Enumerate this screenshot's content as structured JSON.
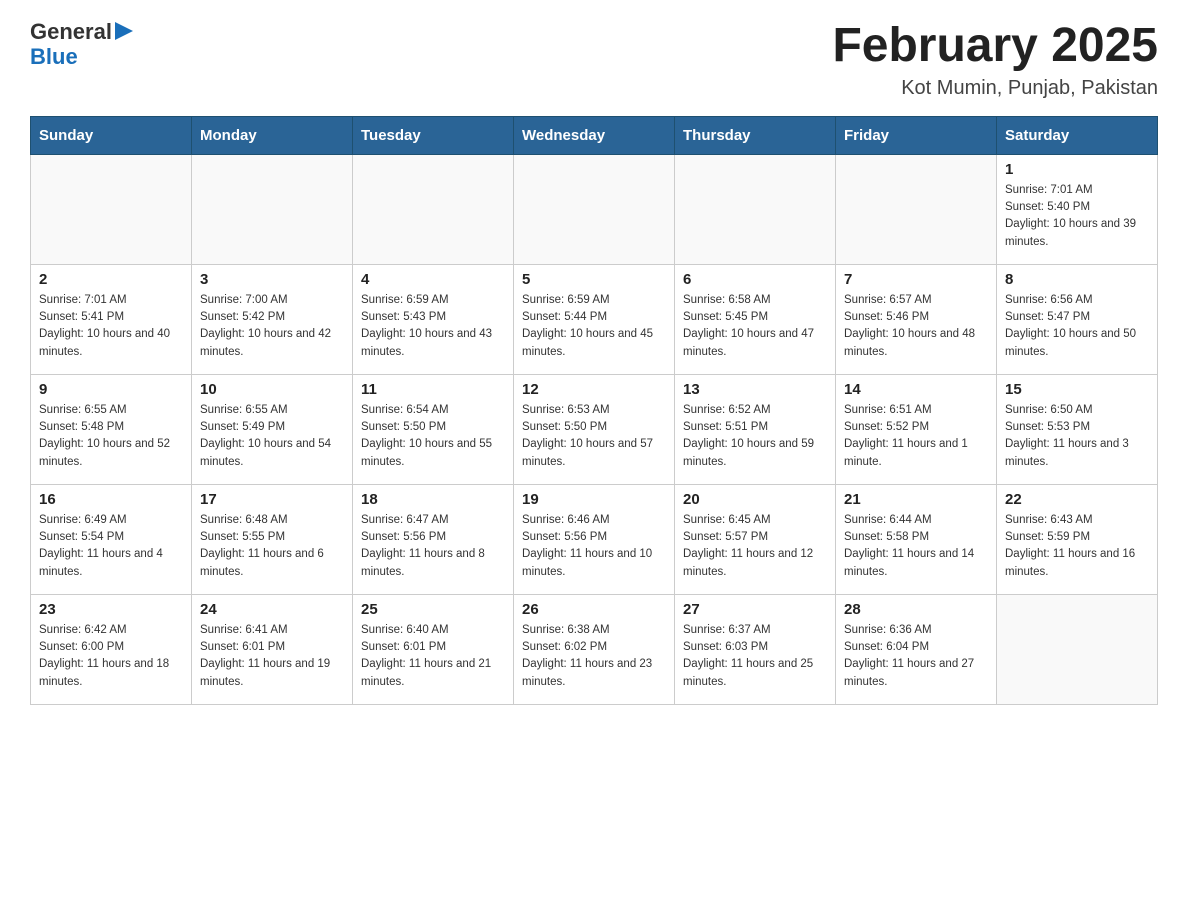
{
  "header": {
    "logo_general": "General",
    "logo_blue": "Blue",
    "month_title": "February 2025",
    "location": "Kot Mumin, Punjab, Pakistan"
  },
  "days_of_week": [
    "Sunday",
    "Monday",
    "Tuesday",
    "Wednesday",
    "Thursday",
    "Friday",
    "Saturday"
  ],
  "weeks": [
    [
      {
        "day": "",
        "sunrise": "",
        "sunset": "",
        "daylight": ""
      },
      {
        "day": "",
        "sunrise": "",
        "sunset": "",
        "daylight": ""
      },
      {
        "day": "",
        "sunrise": "",
        "sunset": "",
        "daylight": ""
      },
      {
        "day": "",
        "sunrise": "",
        "sunset": "",
        "daylight": ""
      },
      {
        "day": "",
        "sunrise": "",
        "sunset": "",
        "daylight": ""
      },
      {
        "day": "",
        "sunrise": "",
        "sunset": "",
        "daylight": ""
      },
      {
        "day": "1",
        "sunrise": "Sunrise: 7:01 AM",
        "sunset": "Sunset: 5:40 PM",
        "daylight": "Daylight: 10 hours and 39 minutes."
      }
    ],
    [
      {
        "day": "2",
        "sunrise": "Sunrise: 7:01 AM",
        "sunset": "Sunset: 5:41 PM",
        "daylight": "Daylight: 10 hours and 40 minutes."
      },
      {
        "day": "3",
        "sunrise": "Sunrise: 7:00 AM",
        "sunset": "Sunset: 5:42 PM",
        "daylight": "Daylight: 10 hours and 42 minutes."
      },
      {
        "day": "4",
        "sunrise": "Sunrise: 6:59 AM",
        "sunset": "Sunset: 5:43 PM",
        "daylight": "Daylight: 10 hours and 43 minutes."
      },
      {
        "day": "5",
        "sunrise": "Sunrise: 6:59 AM",
        "sunset": "Sunset: 5:44 PM",
        "daylight": "Daylight: 10 hours and 45 minutes."
      },
      {
        "day": "6",
        "sunrise": "Sunrise: 6:58 AM",
        "sunset": "Sunset: 5:45 PM",
        "daylight": "Daylight: 10 hours and 47 minutes."
      },
      {
        "day": "7",
        "sunrise": "Sunrise: 6:57 AM",
        "sunset": "Sunset: 5:46 PM",
        "daylight": "Daylight: 10 hours and 48 minutes."
      },
      {
        "day": "8",
        "sunrise": "Sunrise: 6:56 AM",
        "sunset": "Sunset: 5:47 PM",
        "daylight": "Daylight: 10 hours and 50 minutes."
      }
    ],
    [
      {
        "day": "9",
        "sunrise": "Sunrise: 6:55 AM",
        "sunset": "Sunset: 5:48 PM",
        "daylight": "Daylight: 10 hours and 52 minutes."
      },
      {
        "day": "10",
        "sunrise": "Sunrise: 6:55 AM",
        "sunset": "Sunset: 5:49 PM",
        "daylight": "Daylight: 10 hours and 54 minutes."
      },
      {
        "day": "11",
        "sunrise": "Sunrise: 6:54 AM",
        "sunset": "Sunset: 5:50 PM",
        "daylight": "Daylight: 10 hours and 55 minutes."
      },
      {
        "day": "12",
        "sunrise": "Sunrise: 6:53 AM",
        "sunset": "Sunset: 5:50 PM",
        "daylight": "Daylight: 10 hours and 57 minutes."
      },
      {
        "day": "13",
        "sunrise": "Sunrise: 6:52 AM",
        "sunset": "Sunset: 5:51 PM",
        "daylight": "Daylight: 10 hours and 59 minutes."
      },
      {
        "day": "14",
        "sunrise": "Sunrise: 6:51 AM",
        "sunset": "Sunset: 5:52 PM",
        "daylight": "Daylight: 11 hours and 1 minute."
      },
      {
        "day": "15",
        "sunrise": "Sunrise: 6:50 AM",
        "sunset": "Sunset: 5:53 PM",
        "daylight": "Daylight: 11 hours and 3 minutes."
      }
    ],
    [
      {
        "day": "16",
        "sunrise": "Sunrise: 6:49 AM",
        "sunset": "Sunset: 5:54 PM",
        "daylight": "Daylight: 11 hours and 4 minutes."
      },
      {
        "day": "17",
        "sunrise": "Sunrise: 6:48 AM",
        "sunset": "Sunset: 5:55 PM",
        "daylight": "Daylight: 11 hours and 6 minutes."
      },
      {
        "day": "18",
        "sunrise": "Sunrise: 6:47 AM",
        "sunset": "Sunset: 5:56 PM",
        "daylight": "Daylight: 11 hours and 8 minutes."
      },
      {
        "day": "19",
        "sunrise": "Sunrise: 6:46 AM",
        "sunset": "Sunset: 5:56 PM",
        "daylight": "Daylight: 11 hours and 10 minutes."
      },
      {
        "day": "20",
        "sunrise": "Sunrise: 6:45 AM",
        "sunset": "Sunset: 5:57 PM",
        "daylight": "Daylight: 11 hours and 12 minutes."
      },
      {
        "day": "21",
        "sunrise": "Sunrise: 6:44 AM",
        "sunset": "Sunset: 5:58 PM",
        "daylight": "Daylight: 11 hours and 14 minutes."
      },
      {
        "day": "22",
        "sunrise": "Sunrise: 6:43 AM",
        "sunset": "Sunset: 5:59 PM",
        "daylight": "Daylight: 11 hours and 16 minutes."
      }
    ],
    [
      {
        "day": "23",
        "sunrise": "Sunrise: 6:42 AM",
        "sunset": "Sunset: 6:00 PM",
        "daylight": "Daylight: 11 hours and 18 minutes."
      },
      {
        "day": "24",
        "sunrise": "Sunrise: 6:41 AM",
        "sunset": "Sunset: 6:01 PM",
        "daylight": "Daylight: 11 hours and 19 minutes."
      },
      {
        "day": "25",
        "sunrise": "Sunrise: 6:40 AM",
        "sunset": "Sunset: 6:01 PM",
        "daylight": "Daylight: 11 hours and 21 minutes."
      },
      {
        "day": "26",
        "sunrise": "Sunrise: 6:38 AM",
        "sunset": "Sunset: 6:02 PM",
        "daylight": "Daylight: 11 hours and 23 minutes."
      },
      {
        "day": "27",
        "sunrise": "Sunrise: 6:37 AM",
        "sunset": "Sunset: 6:03 PM",
        "daylight": "Daylight: 11 hours and 25 minutes."
      },
      {
        "day": "28",
        "sunrise": "Sunrise: 6:36 AM",
        "sunset": "Sunset: 6:04 PM",
        "daylight": "Daylight: 11 hours and 27 minutes."
      },
      {
        "day": "",
        "sunrise": "",
        "sunset": "",
        "daylight": ""
      }
    ]
  ]
}
